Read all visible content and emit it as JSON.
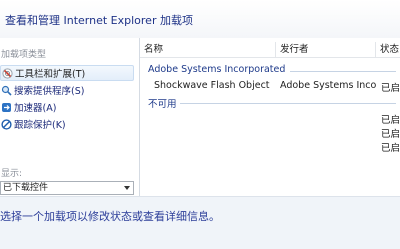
{
  "window": {
    "title": "查看和管理 Internet Explorer 加载项"
  },
  "sidebar": {
    "types_label": "加载项类型",
    "items": [
      {
        "label": "工具栏和扩展(T)",
        "icon": "toolbar-extensions-icon",
        "selected": true
      },
      {
        "label": "搜索提供程序(S)",
        "icon": "search-provider-icon",
        "selected": false
      },
      {
        "label": "加速器(A)",
        "icon": "accelerator-icon",
        "selected": false
      },
      {
        "label": "跟踪保护(K)",
        "icon": "tracking-protection-icon",
        "selected": false
      }
    ],
    "show_label": "显示:",
    "show_value": "已下载控件"
  },
  "list": {
    "columns": [
      "名称",
      "发行者",
      "状态"
    ],
    "groups": [
      {
        "header": "Adobe Systems Incorporated",
        "rows": [
          {
            "name": "Shockwave Flash Object",
            "publisher": "Adobe Systems Incor...",
            "status": "已启"
          }
        ]
      },
      {
        "header": "不可用",
        "rows": [
          {
            "name": "",
            "publisher": "",
            "status": "已启"
          },
          {
            "name": "",
            "publisher": "",
            "status": "已启"
          },
          {
            "name": "",
            "publisher": "",
            "status": "已启"
          }
        ]
      }
    ]
  },
  "footer": {
    "hint": "选择一个加载项以修改状态或查看详细信息。"
  },
  "colors": {
    "title": "#1e3287",
    "footer_text": "#2b3d99",
    "group_header": "#1e3a8a"
  }
}
